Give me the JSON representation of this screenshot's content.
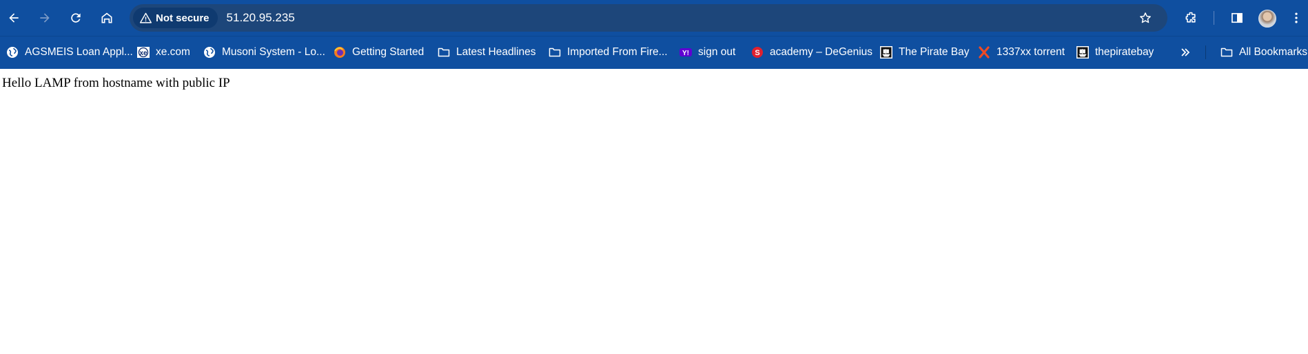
{
  "browser": {
    "security_label": "Not secure",
    "url": "51.20.95.235",
    "colors": {
      "chrome": "#0f4fa0",
      "omnibox": "#1d467a",
      "chip": "#0f3a70",
      "text": "#ffffff"
    }
  },
  "toolbar": {
    "back_icon": "arrow-left-icon",
    "forward_icon": "arrow-right-icon",
    "reload_icon": "reload-icon",
    "home_icon": "home-icon",
    "star_icon": "star-icon",
    "extensions_icon": "puzzle-icon",
    "side_panel_icon": "side-panel-icon",
    "menu_icon": "kebab-menu-icon"
  },
  "bookmarks": [
    {
      "label": "AGSMEIS Loan Appl...",
      "icon": "globe-icon"
    },
    {
      "label": "xe.com",
      "icon": "xe-icon"
    },
    {
      "label": "Musoni System - Lo...",
      "icon": "globe-icon"
    },
    {
      "label": "Getting Started",
      "icon": "firefox-icon"
    },
    {
      "label": "Latest Headlines",
      "icon": "folder-icon"
    },
    {
      "label": "Imported From Fire...",
      "icon": "folder-icon"
    },
    {
      "label": "sign out",
      "icon": "yahoo-icon"
    },
    {
      "label": "academy – DeGenius",
      "icon": "degenius-icon"
    },
    {
      "label": "The Pirate Bay",
      "icon": "pirate-ship-icon"
    },
    {
      "label": "1337xx torrent",
      "icon": "x-logo-icon"
    },
    {
      "label": "thepiratebay",
      "icon": "pirate-ship-icon"
    }
  ],
  "bookmarks_overflow_icon": "double-chevron-right-icon",
  "all_bookmarks_label": "All Bookmarks",
  "page": {
    "text": "Hello LAMP from hostname with public IP"
  }
}
